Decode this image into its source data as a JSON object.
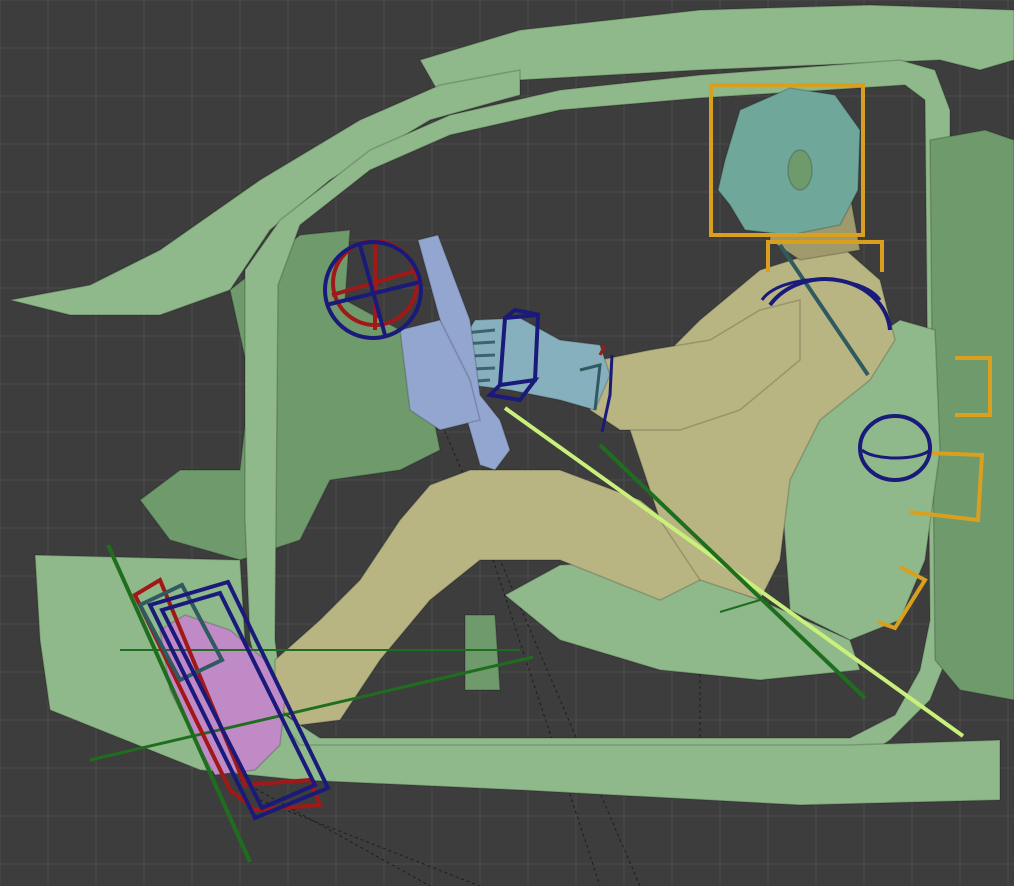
{
  "viewport": {
    "background": "#3d3d3d",
    "grid_color": "#4a4a4a",
    "grid_visible": true
  },
  "colors": {
    "cabin": "#8fb98a",
    "cabin_dark": "#6f9a6c",
    "cabin_light": "#a9cfa2",
    "driver_body": "#b8b583",
    "driver_body_dark": "#9e9a6c",
    "head": "#6fa89a",
    "steering": "#93a6cf",
    "glove": "#86b0bd",
    "shoe": "#c08ac7",
    "gizmo_head": "#d9a020",
    "gizmo_joint": "#1a1a7a",
    "gizmo_red": "#a01818",
    "gizmo_teal": "#2f5a5f",
    "line_green": "#1f6e1f",
    "line_lime": "#c8f07a"
  },
  "icons": {
    "head_bbox": "square-outline-icon",
    "shoulder_gizmo": "circle-gizmo-icon",
    "hip_gizmo": "circle-gizmo-icon",
    "wheel_gizmo": "crosshair-gizmo-icon",
    "hand_gizmo": "box-gizmo-icon",
    "foot_gizmo": "box-gizmo-icon"
  }
}
